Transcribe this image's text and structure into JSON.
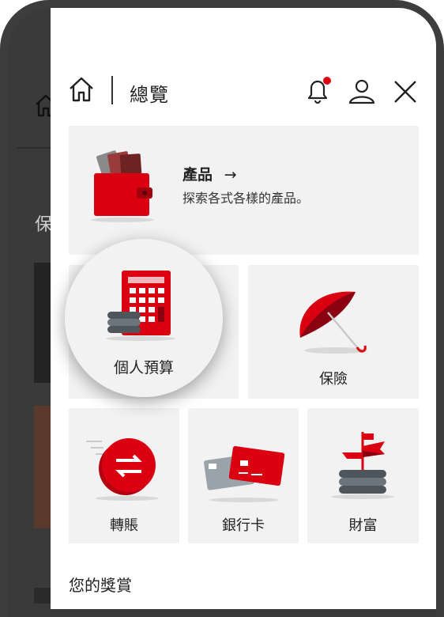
{
  "header": {
    "title": "總覽",
    "icons": [
      "home-icon",
      "bell-icon",
      "user-icon",
      "close-icon"
    ],
    "notification_dot_color": "#db0011"
  },
  "background_page": {
    "section_text": "保險"
  },
  "product_card": {
    "title": "產品",
    "arrow": "→",
    "description": "探索各式各樣的產品。"
  },
  "tiles": {
    "budget": "個人預算",
    "insurance": "保險",
    "transfer": "轉賬",
    "bank_card": "銀行卡",
    "wealth": "財富"
  },
  "section": {
    "rewards": "您的獎賞"
  },
  "colors": {
    "brand_red": "#db0011",
    "tile_bg": "#f2f2f2"
  }
}
